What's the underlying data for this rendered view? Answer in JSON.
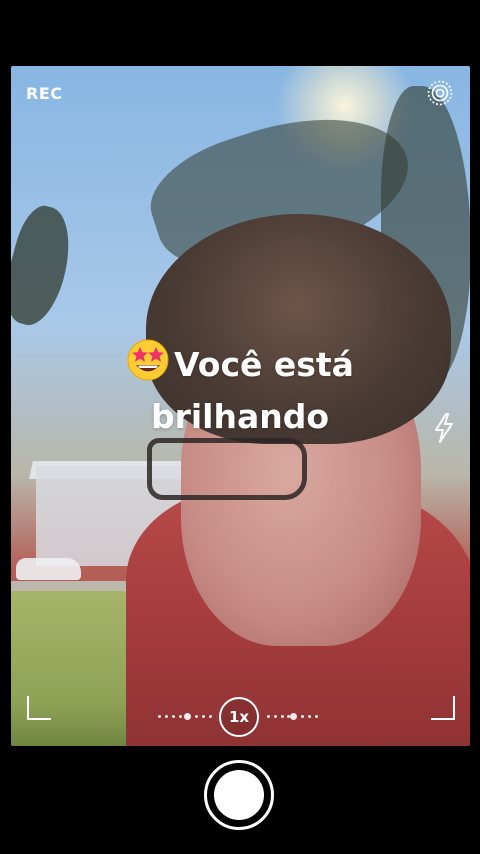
{
  "camera": {
    "rec_label": "REC",
    "headline_line1": "Você está",
    "headline_line2": "brilhando",
    "zoom_label": "1x",
    "icons": {
      "headline_emoji": "star-struck-emoji-icon",
      "live_mode": "live-photo-icon",
      "flash": "flash-icon",
      "shutter": "shutter-button"
    }
  }
}
